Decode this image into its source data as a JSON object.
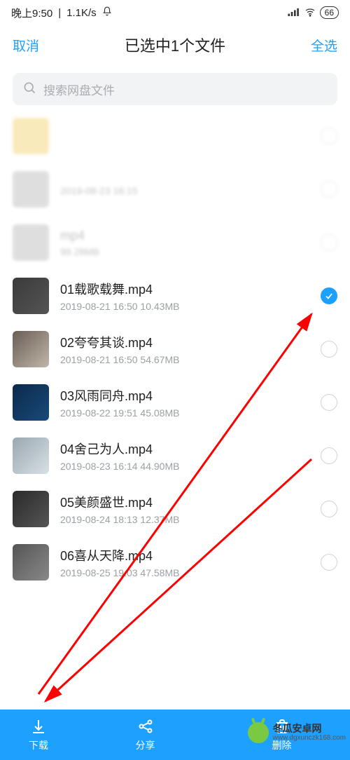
{
  "status": {
    "time": "晚上9:50",
    "net_speed": "1.1K/s",
    "battery": "66"
  },
  "header": {
    "cancel": "取消",
    "title": "已选中1个文件",
    "select_all": "全选"
  },
  "search": {
    "placeholder": "搜索网盘文件"
  },
  "files": [
    {
      "name": "",
      "meta": "",
      "selected": false,
      "redacted": true
    },
    {
      "name": "",
      "meta": "2019-08-23  16:15",
      "selected": false,
      "redacted": true
    },
    {
      "name": "mp4",
      "meta": "99.28MB",
      "selected": false,
      "redacted": true
    },
    {
      "name": "01载歌载舞.mp4",
      "meta": "2019-08-21  16:50   10.43MB",
      "selected": true,
      "redacted": false
    },
    {
      "name": "02夸夸其谈.mp4",
      "meta": "2019-08-21  16:50   54.67MB",
      "selected": false,
      "redacted": false
    },
    {
      "name": "03风雨同舟.mp4",
      "meta": "2019-08-22  19:51   45.08MB",
      "selected": false,
      "redacted": false
    },
    {
      "name": "04舍己为人.mp4",
      "meta": "2019-08-23  16:14   44.90MB",
      "selected": false,
      "redacted": false
    },
    {
      "name": "05美颜盛世.mp4",
      "meta": "2019-08-24  18:13   12.37MB",
      "selected": false,
      "redacted": false
    },
    {
      "name": "06喜从天降.mp4",
      "meta": "2019-08-25  19:03   47.58MB",
      "selected": false,
      "redacted": false
    }
  ],
  "bottom": {
    "download": "下载",
    "share": "分享",
    "delete": "删除"
  },
  "watermark": {
    "line1": "冬瓜安卓网",
    "line2": "www.dgxunczk168.com"
  }
}
